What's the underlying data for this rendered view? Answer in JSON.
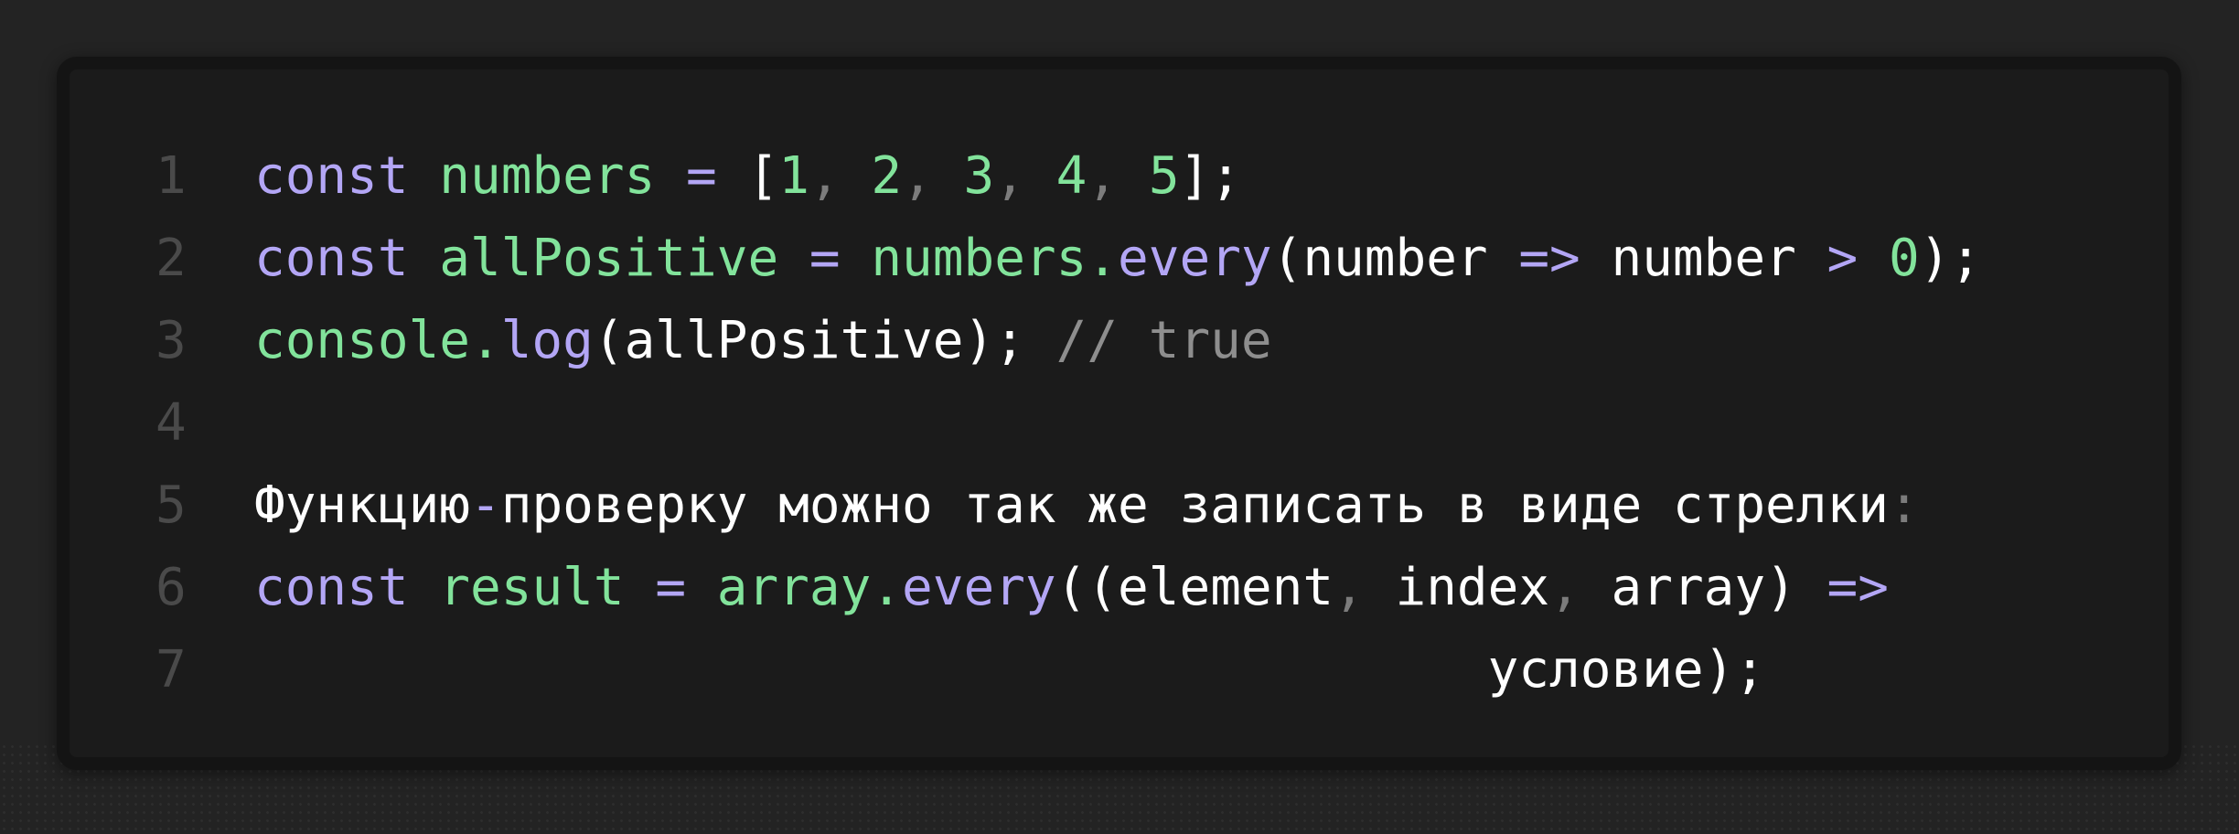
{
  "colors": {
    "background": "#232323",
    "card": "#1b1b1b",
    "card_border": "#141414",
    "keyword": "#b3a6f5",
    "identifier": "#82e39b",
    "plain": "#ffffff",
    "comment": "#8e8e8e",
    "line_number": "#4a4a4a"
  },
  "code": {
    "lines": [
      {
        "number": "1",
        "tokens": [
          {
            "t": "kw",
            "v": "const"
          },
          {
            "t": "pl",
            "v": " "
          },
          {
            "t": "id",
            "v": "numbers"
          },
          {
            "t": "pl",
            "v": " "
          },
          {
            "t": "op",
            "v": "="
          },
          {
            "t": "pl",
            "v": " ["
          },
          {
            "t": "num",
            "v": "1"
          },
          {
            "t": "pn",
            "v": ", "
          },
          {
            "t": "num",
            "v": "2"
          },
          {
            "t": "pn",
            "v": ", "
          },
          {
            "t": "num",
            "v": "3"
          },
          {
            "t": "pn",
            "v": ", "
          },
          {
            "t": "num",
            "v": "4"
          },
          {
            "t": "pn",
            "v": ", "
          },
          {
            "t": "num",
            "v": "5"
          },
          {
            "t": "pl",
            "v": "];"
          }
        ]
      },
      {
        "number": "2",
        "tokens": [
          {
            "t": "kw",
            "v": "const"
          },
          {
            "t": "pl",
            "v": " "
          },
          {
            "t": "id",
            "v": "allPositive"
          },
          {
            "t": "pl",
            "v": " "
          },
          {
            "t": "op",
            "v": "="
          },
          {
            "t": "pl",
            "v": " "
          },
          {
            "t": "id",
            "v": "numbers."
          },
          {
            "t": "kw",
            "v": "every"
          },
          {
            "t": "pl",
            "v": "(number "
          },
          {
            "t": "op",
            "v": "=>"
          },
          {
            "t": "pl",
            "v": " number "
          },
          {
            "t": "op",
            "v": ">"
          },
          {
            "t": "pl",
            "v": " "
          },
          {
            "t": "num",
            "v": "0"
          },
          {
            "t": "pl",
            "v": ");"
          }
        ]
      },
      {
        "number": "3",
        "tokens": [
          {
            "t": "id",
            "v": "console."
          },
          {
            "t": "kw",
            "v": "log"
          },
          {
            "t": "pl",
            "v": "(allPositive); "
          },
          {
            "t": "cm",
            "v": "// true"
          }
        ]
      },
      {
        "number": "4",
        "tokens": []
      },
      {
        "number": "5",
        "tokens": [
          {
            "t": "pl",
            "v": "Функцию"
          },
          {
            "t": "op",
            "v": "-"
          },
          {
            "t": "pl",
            "v": "проверку можно так же записать в виде стрелки"
          },
          {
            "t": "pn",
            "v": ":"
          }
        ]
      },
      {
        "number": "6",
        "tokens": [
          {
            "t": "kw",
            "v": "const"
          },
          {
            "t": "pl",
            "v": " "
          },
          {
            "t": "id",
            "v": "result"
          },
          {
            "t": "pl",
            "v": " "
          },
          {
            "t": "op",
            "v": "="
          },
          {
            "t": "pl",
            "v": " "
          },
          {
            "t": "id",
            "v": "array."
          },
          {
            "t": "kw",
            "v": "every"
          },
          {
            "t": "pl",
            "v": "((element"
          },
          {
            "t": "pn",
            "v": ", "
          },
          {
            "t": "pl",
            "v": "index"
          },
          {
            "t": "pn",
            "v": ", "
          },
          {
            "t": "pl",
            "v": "array) "
          },
          {
            "t": "op",
            "v": "=>"
          }
        ]
      },
      {
        "number": "7",
        "tokens": [
          {
            "t": "pl",
            "v": "                                        условие);"
          }
        ]
      }
    ]
  }
}
